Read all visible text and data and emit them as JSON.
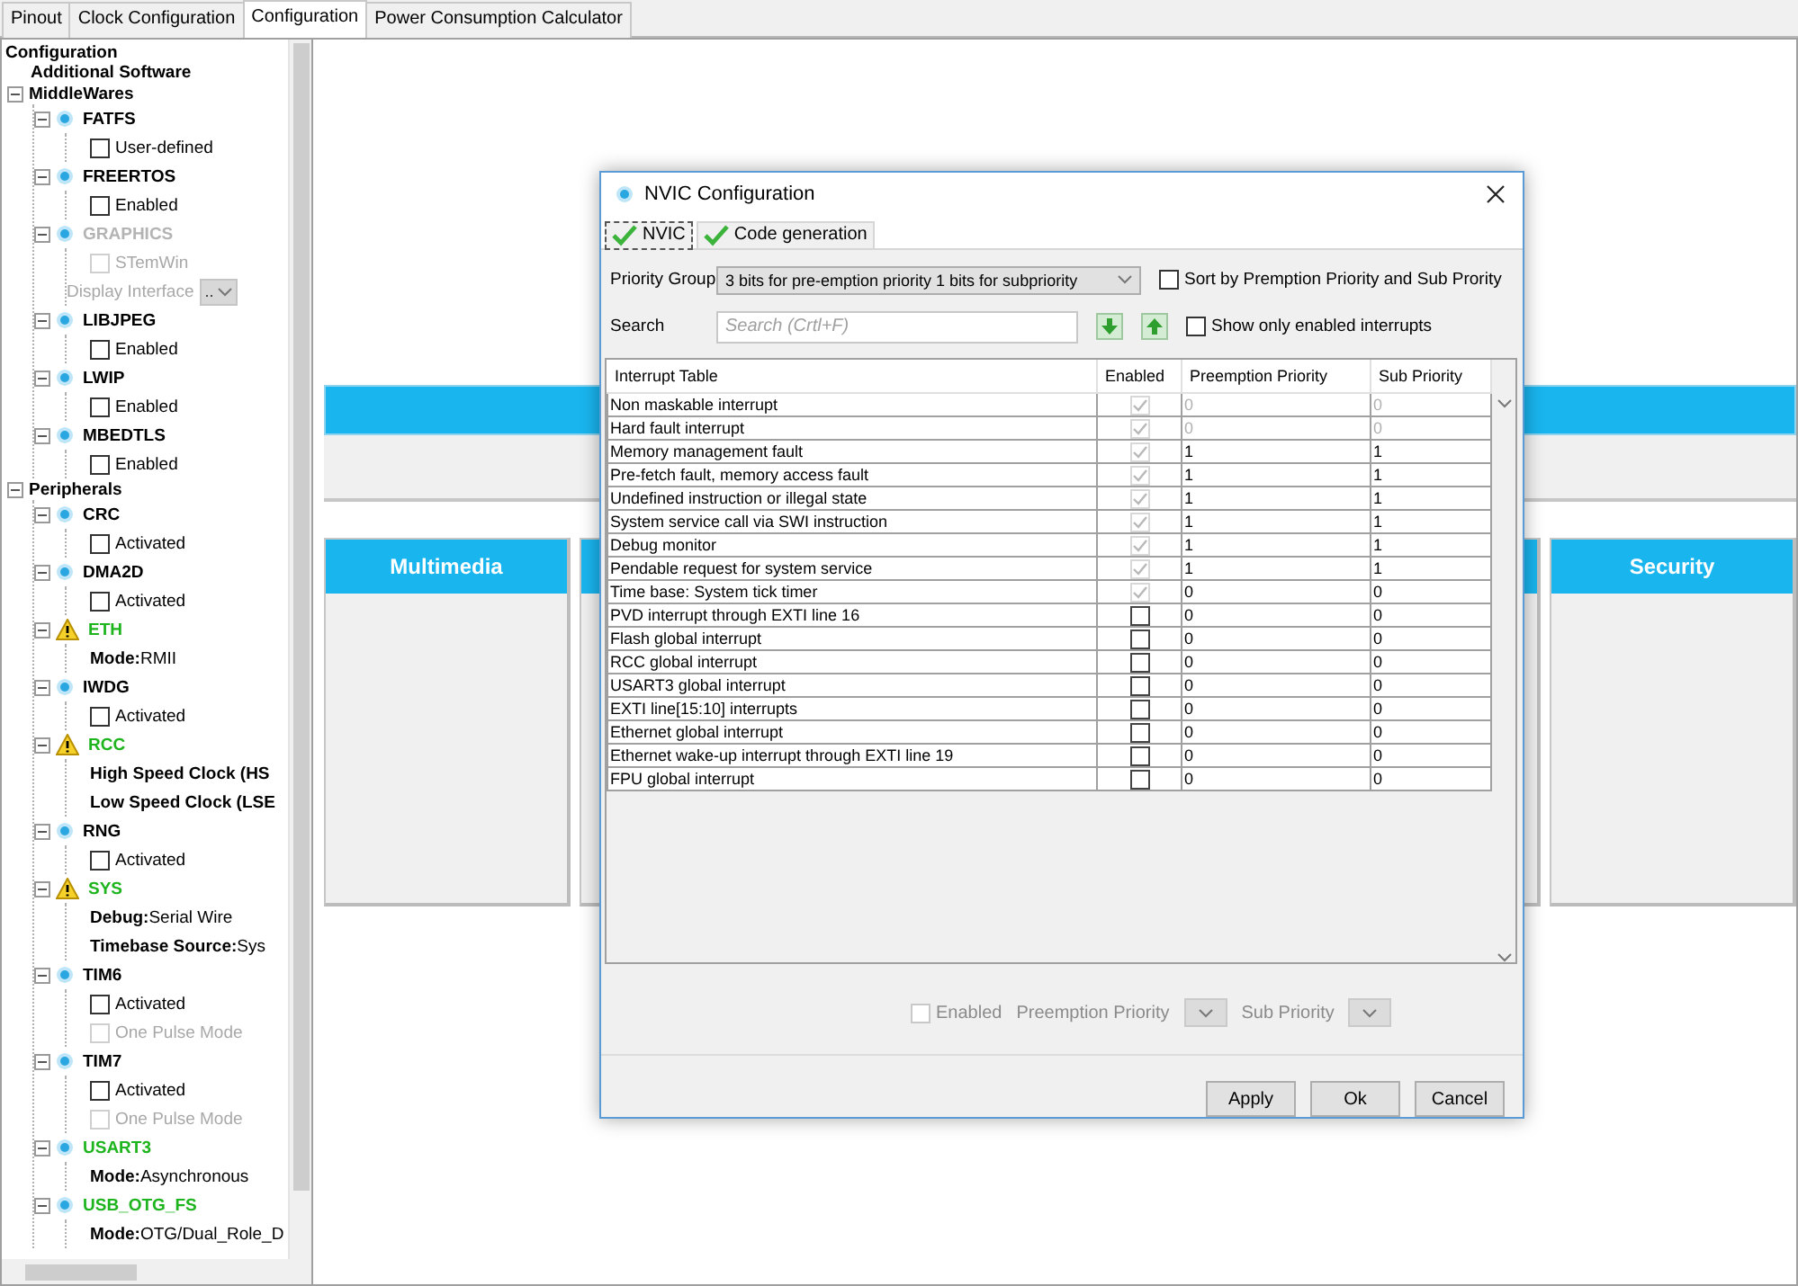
{
  "tabs": [
    {
      "label": "Pinout",
      "selected": false
    },
    {
      "label": "Clock Configuration",
      "selected": false
    },
    {
      "label": "Configuration",
      "selected": true
    },
    {
      "label": "Power Consumption Calculator",
      "selected": false
    }
  ],
  "tree": {
    "label": "Configuration",
    "children": [
      {
        "kind": "category",
        "label": "Additional Software",
        "expanded": false
      },
      {
        "kind": "category",
        "label": "MiddleWares",
        "expanded": true,
        "children": [
          {
            "kind": "component",
            "label": "FATFS",
            "configured": false,
            "warning": false,
            "children": [
              {
                "kind": "checkbox",
                "label": "User-defined",
                "checked": false,
                "disabled": false
              }
            ]
          },
          {
            "kind": "component",
            "label": "FREERTOS",
            "configured": false,
            "warning": false,
            "children": [
              {
                "kind": "checkbox",
                "label": "Enabled",
                "checked": false,
                "disabled": false
              }
            ]
          },
          {
            "kind": "component",
            "label": "GRAPHICS",
            "unavailable": true,
            "warning": false,
            "children": [
              {
                "kind": "checkbox",
                "label": "STemWin",
                "checked": false,
                "disabled": true
              },
              {
                "kind": "select",
                "label": "Display Interface",
                "value": ".."
              }
            ]
          },
          {
            "kind": "component",
            "label": "LIBJPEG",
            "configured": false,
            "warning": false,
            "children": [
              {
                "kind": "checkbox",
                "label": "Enabled",
                "checked": false,
                "disabled": false
              }
            ]
          },
          {
            "kind": "component",
            "label": "LWIP",
            "configured": false,
            "warning": false,
            "children": [
              {
                "kind": "checkbox",
                "label": "Enabled",
                "checked": false,
                "disabled": false
              }
            ]
          },
          {
            "kind": "component",
            "label": "MBEDTLS",
            "configured": false,
            "warning": false,
            "children": [
              {
                "kind": "checkbox",
                "label": "Enabled",
                "checked": false,
                "disabled": false
              }
            ]
          }
        ]
      },
      {
        "kind": "category",
        "label": "Peripherals",
        "expanded": true,
        "children": [
          {
            "kind": "component",
            "label": "CRC",
            "configured": false,
            "warning": false,
            "children": [
              {
                "kind": "checkbox",
                "label": "Activated",
                "checked": false,
                "disabled": false
              }
            ]
          },
          {
            "kind": "component",
            "label": "DMA2D",
            "configured": false,
            "warning": false,
            "children": [
              {
                "kind": "checkbox",
                "label": "Activated",
                "checked": false,
                "disabled": false
              }
            ]
          },
          {
            "kind": "component",
            "label": "ETH",
            "configured": true,
            "warning": true,
            "children": [
              {
                "kind": "setting",
                "name": "Mode:",
                "value": "RMII"
              }
            ]
          },
          {
            "kind": "component",
            "label": "IWDG",
            "configured": false,
            "warning": false,
            "children": [
              {
                "kind": "checkbox",
                "label": "Activated",
                "checked": false,
                "disabled": false
              }
            ]
          },
          {
            "kind": "component",
            "label": "RCC",
            "configured": true,
            "warning": true,
            "children": [
              {
                "kind": "setting",
                "name": "High Speed Clock (HS"
              },
              {
                "kind": "setting",
                "name": "Low Speed Clock (LSE"
              }
            ]
          },
          {
            "kind": "component",
            "label": "RNG",
            "configured": false,
            "warning": false,
            "children": [
              {
                "kind": "checkbox",
                "label": "Activated",
                "checked": false,
                "disabled": false
              }
            ]
          },
          {
            "kind": "component",
            "label": "SYS",
            "configured": true,
            "warning": true,
            "children": [
              {
                "kind": "setting",
                "name": "Debug:",
                "value": "Serial Wire"
              },
              {
                "kind": "setting",
                "name": "Timebase Source:",
                "value": "Sys"
              }
            ]
          },
          {
            "kind": "component",
            "label": "TIM6",
            "configured": false,
            "warning": false,
            "children": [
              {
                "kind": "checkbox",
                "label": "Activated",
                "checked": false,
                "disabled": false
              },
              {
                "kind": "checkbox",
                "label": "One Pulse Mode",
                "checked": false,
                "disabled": true
              }
            ]
          },
          {
            "kind": "component",
            "label": "TIM7",
            "configured": false,
            "warning": false,
            "children": [
              {
                "kind": "checkbox",
                "label": "Activated",
                "checked": false,
                "disabled": false
              },
              {
                "kind": "checkbox",
                "label": "One Pulse Mode",
                "checked": false,
                "disabled": true
              }
            ]
          },
          {
            "kind": "component",
            "label": "USART3",
            "configured": true,
            "warning": false,
            "children": [
              {
                "kind": "setting",
                "name": "Mode:",
                "value": "Asynchronous"
              }
            ]
          },
          {
            "kind": "component",
            "label": "USB_OTG_FS",
            "configured": true,
            "warning": false,
            "children": [
              {
                "kind": "setting",
                "name": "Mode:",
                "value": "OTG/Dual_Role_D"
              }
            ]
          }
        ]
      }
    ]
  },
  "canvas": {
    "panels": [
      {
        "title": "Multimedia"
      },
      {
        "title": "Security"
      }
    ]
  },
  "dialog": {
    "title": "NVIC Configuration",
    "tabs": [
      {
        "label": "NVIC",
        "selected": true
      },
      {
        "label": "Code generation",
        "selected": false
      }
    ],
    "priority_group": {
      "label": "Priority Group",
      "value": "3 bits for pre-emption priority 1 bits for subpriority"
    },
    "sort_option": {
      "label": "Sort by Premption Priority and Sub Prority",
      "checked": false
    },
    "search": {
      "label": "Search",
      "placeholder": "Search (Crtl+F)"
    },
    "enabled_only_option": {
      "label": "Show only enabled interrupts",
      "checked": false
    },
    "table": {
      "columns": [
        "Interrupt Table",
        "Enabled",
        "Preemption Priority",
        "Sub Priority"
      ],
      "rows": [
        {
          "name": "Non maskable interrupt",
          "enabled": true,
          "locked": true,
          "preemption": "0",
          "sub": "0",
          "priority_disabled": true
        },
        {
          "name": "Hard fault interrupt",
          "enabled": true,
          "locked": true,
          "preemption": "0",
          "sub": "0",
          "priority_disabled": true
        },
        {
          "name": "Memory management fault",
          "enabled": true,
          "locked": true,
          "preemption": "1",
          "sub": "1",
          "priority_disabled": false
        },
        {
          "name": "Pre-fetch fault, memory access fault",
          "enabled": true,
          "locked": true,
          "preemption": "1",
          "sub": "1",
          "priority_disabled": false
        },
        {
          "name": "Undefined instruction or illegal state",
          "enabled": true,
          "locked": true,
          "preemption": "1",
          "sub": "1",
          "priority_disabled": false
        },
        {
          "name": "System service call via SWI instruction",
          "enabled": true,
          "locked": true,
          "preemption": "1",
          "sub": "1",
          "priority_disabled": false
        },
        {
          "name": "Debug monitor",
          "enabled": true,
          "locked": true,
          "preemption": "1",
          "sub": "1",
          "priority_disabled": false
        },
        {
          "name": "Pendable request for system service",
          "enabled": true,
          "locked": true,
          "preemption": "1",
          "sub": "1",
          "priority_disabled": false
        },
        {
          "name": "Time base: System tick timer",
          "enabled": true,
          "locked": true,
          "preemption": "0",
          "sub": "0",
          "priority_disabled": false
        },
        {
          "name": "PVD interrupt through EXTI line 16",
          "enabled": false,
          "locked": false,
          "preemption": "0",
          "sub": "0",
          "priority_disabled": false
        },
        {
          "name": "Flash global interrupt",
          "enabled": false,
          "locked": false,
          "preemption": "0",
          "sub": "0",
          "priority_disabled": false
        },
        {
          "name": "RCC global interrupt",
          "enabled": false,
          "locked": false,
          "preemption": "0",
          "sub": "0",
          "priority_disabled": false
        },
        {
          "name": "USART3 global interrupt",
          "enabled": false,
          "locked": false,
          "preemption": "0",
          "sub": "0",
          "priority_disabled": false
        },
        {
          "name": "EXTI line[15:10] interrupts",
          "enabled": false,
          "locked": false,
          "preemption": "0",
          "sub": "0",
          "priority_disabled": false
        },
        {
          "name": "Ethernet global interrupt",
          "enabled": false,
          "locked": false,
          "preemption": "0",
          "sub": "0",
          "priority_disabled": false
        },
        {
          "name": "Ethernet wake-up interrupt through EXTI line 19",
          "enabled": false,
          "locked": false,
          "preemption": "0",
          "sub": "0",
          "priority_disabled": false
        },
        {
          "name": "FPU global interrupt",
          "enabled": false,
          "locked": false,
          "preemption": "0",
          "sub": "0",
          "priority_disabled": false
        }
      ]
    },
    "editor": {
      "enabled_label": "Enabled",
      "enabled_checked": false,
      "preemption_label": "Preemption Priority",
      "sub_label": "Sub Priority",
      "disabled": true
    },
    "buttons": [
      "Apply",
      "Ok",
      "Cancel"
    ]
  }
}
